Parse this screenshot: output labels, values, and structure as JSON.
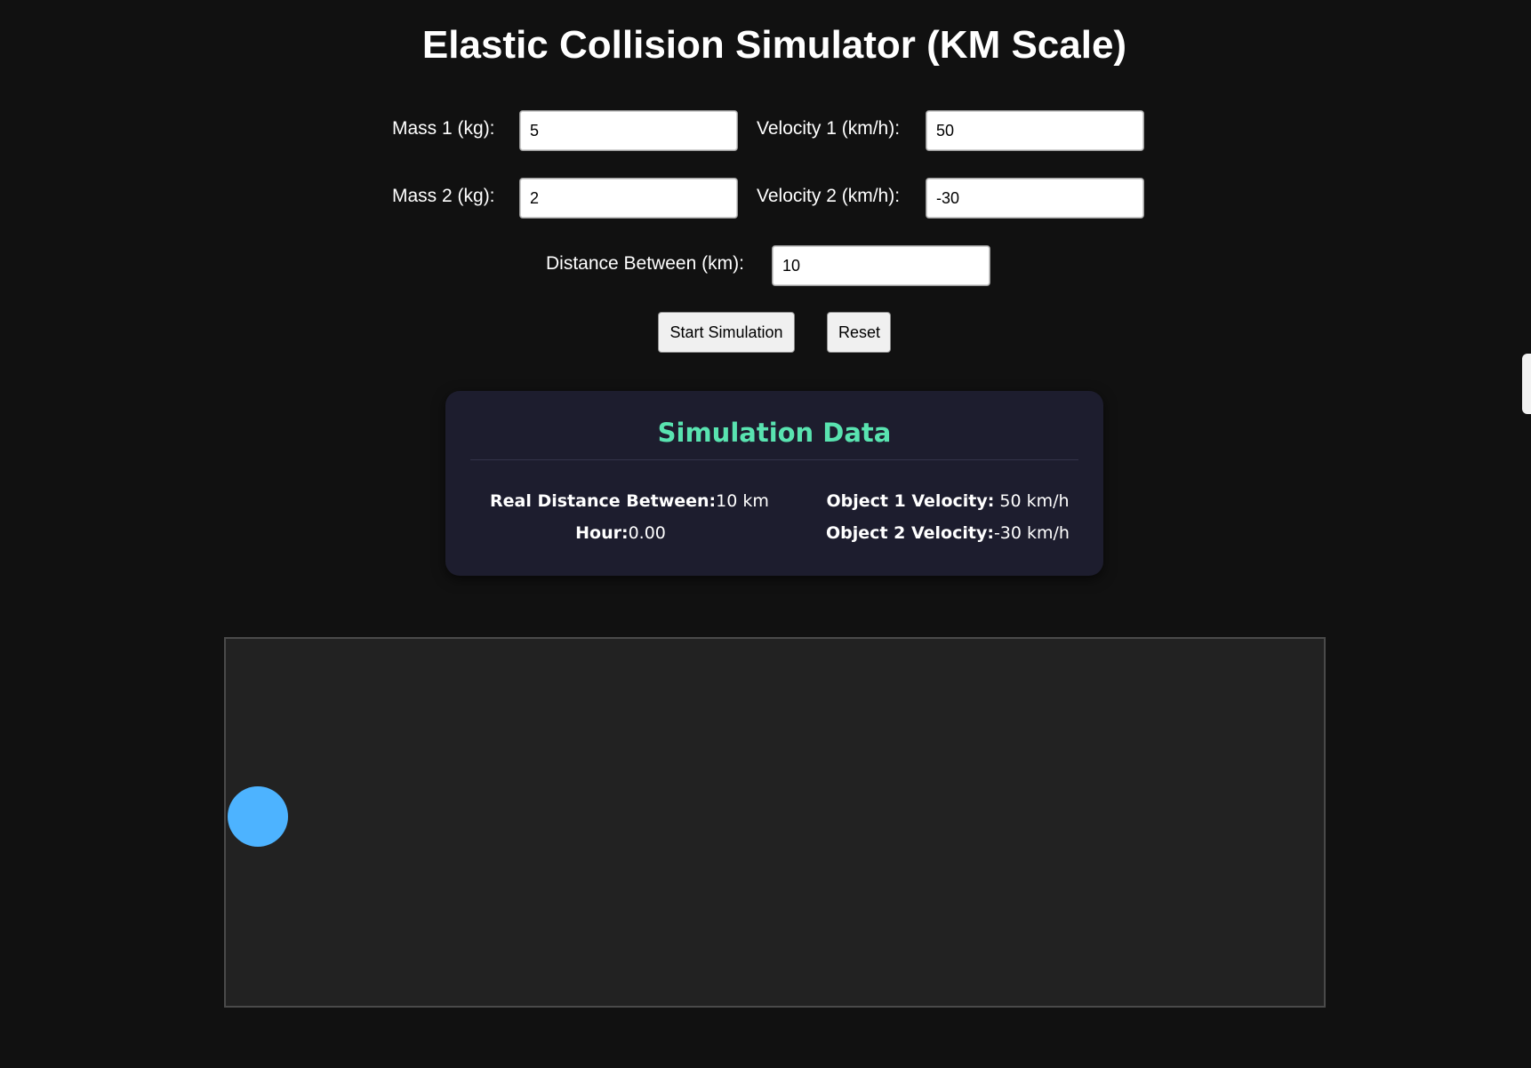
{
  "page": {
    "title": "Elastic Collision Simulator (KM Scale)"
  },
  "form": {
    "mass1_label": "Mass 1 (kg):",
    "mass1_value": "5",
    "velocity1_label": "Velocity 1 (km/h):",
    "velocity1_value": "50",
    "mass2_label": "Mass 2 (kg):",
    "mass2_value": "2",
    "velocity2_label": "Velocity 2 (km/h):",
    "velocity2_value": "-30",
    "distance_label": "Distance Between (km):",
    "distance_value": "10"
  },
  "buttons": {
    "start_label": "Start Simulation",
    "reset_label": "Reset"
  },
  "simulation_data": {
    "title": "Simulation Data",
    "real_distance_label": "Real Distance Between:",
    "real_distance_value": "10 km",
    "hour_label": "Hour:",
    "hour_value": "0.00",
    "object1_velocity_label": "Object 1 Velocity:",
    "object1_velocity_value": " 50 km/h",
    "object2_velocity_label": "Object 2 Velocity:",
    "object2_velocity_value": "-30 km/h"
  },
  "colors": {
    "background": "#111111",
    "panel": "#1d1d2e",
    "accent": "#59e3b0",
    "canvas": "#222222",
    "object1": "#4db3ff"
  }
}
